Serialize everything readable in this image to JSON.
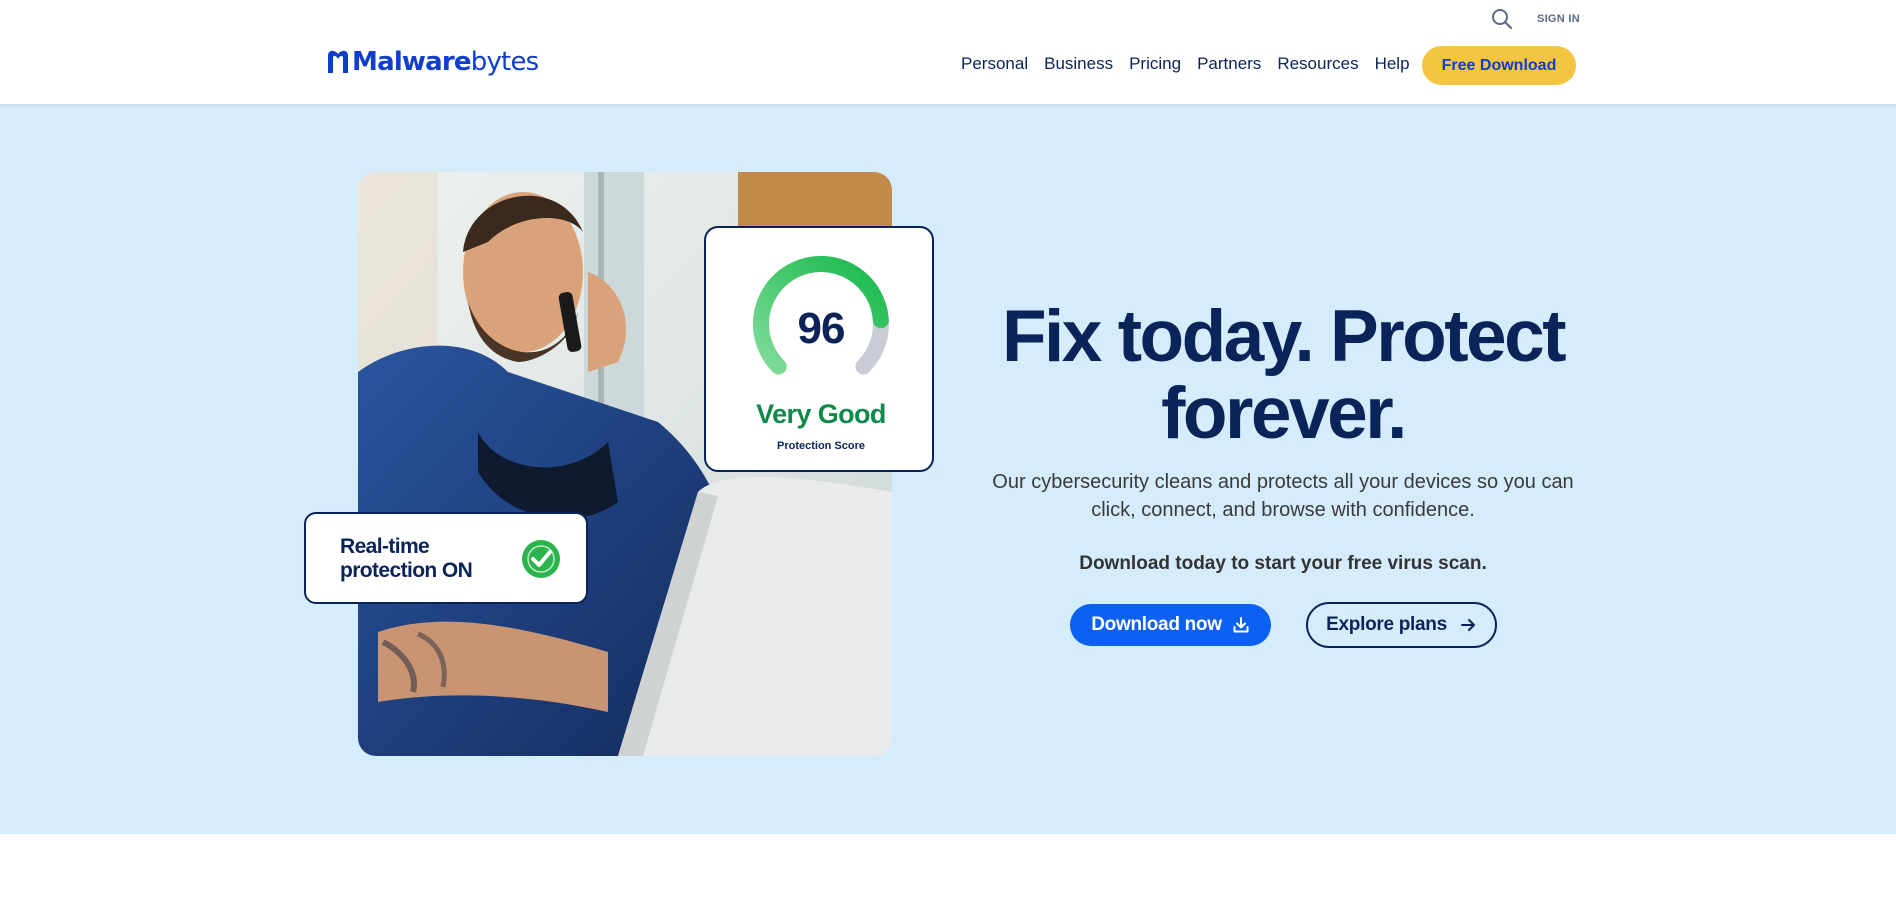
{
  "header": {
    "sign_in": "SIGN IN",
    "logo_bold": "Malware",
    "logo_light": "bytes",
    "nav": [
      "Personal",
      "Business",
      "Pricing",
      "Partners",
      "Resources",
      "Help"
    ],
    "cta": "Free Download"
  },
  "hero": {
    "score_value": "96",
    "score_label": "Very Good",
    "score_caption": "Protection Score",
    "gauge_level": 0.96,
    "realtime_text": "Real-time protection ON",
    "headline": "Fix today. Protect forever.",
    "subheadline": "Our cybersecurity cleans and protects all your devices so you can click, connect, and browse with confidence.",
    "cta_text": "Download today to start your free virus scan.",
    "primary_button": "Download now",
    "secondary_button": "Explore plans"
  },
  "icons": [
    "search-icon",
    "logo-mark-icon",
    "check-icon",
    "download-icon",
    "arrow-right-icon"
  ],
  "colors": {
    "brand_blue": "#0d3ecc",
    "navy": "#0a2359",
    "cta_yellow": "#f4c543",
    "primary_button": "#0d61f2",
    "hero_background": "#d5ecfc",
    "score_green": "#0d8a4a"
  }
}
